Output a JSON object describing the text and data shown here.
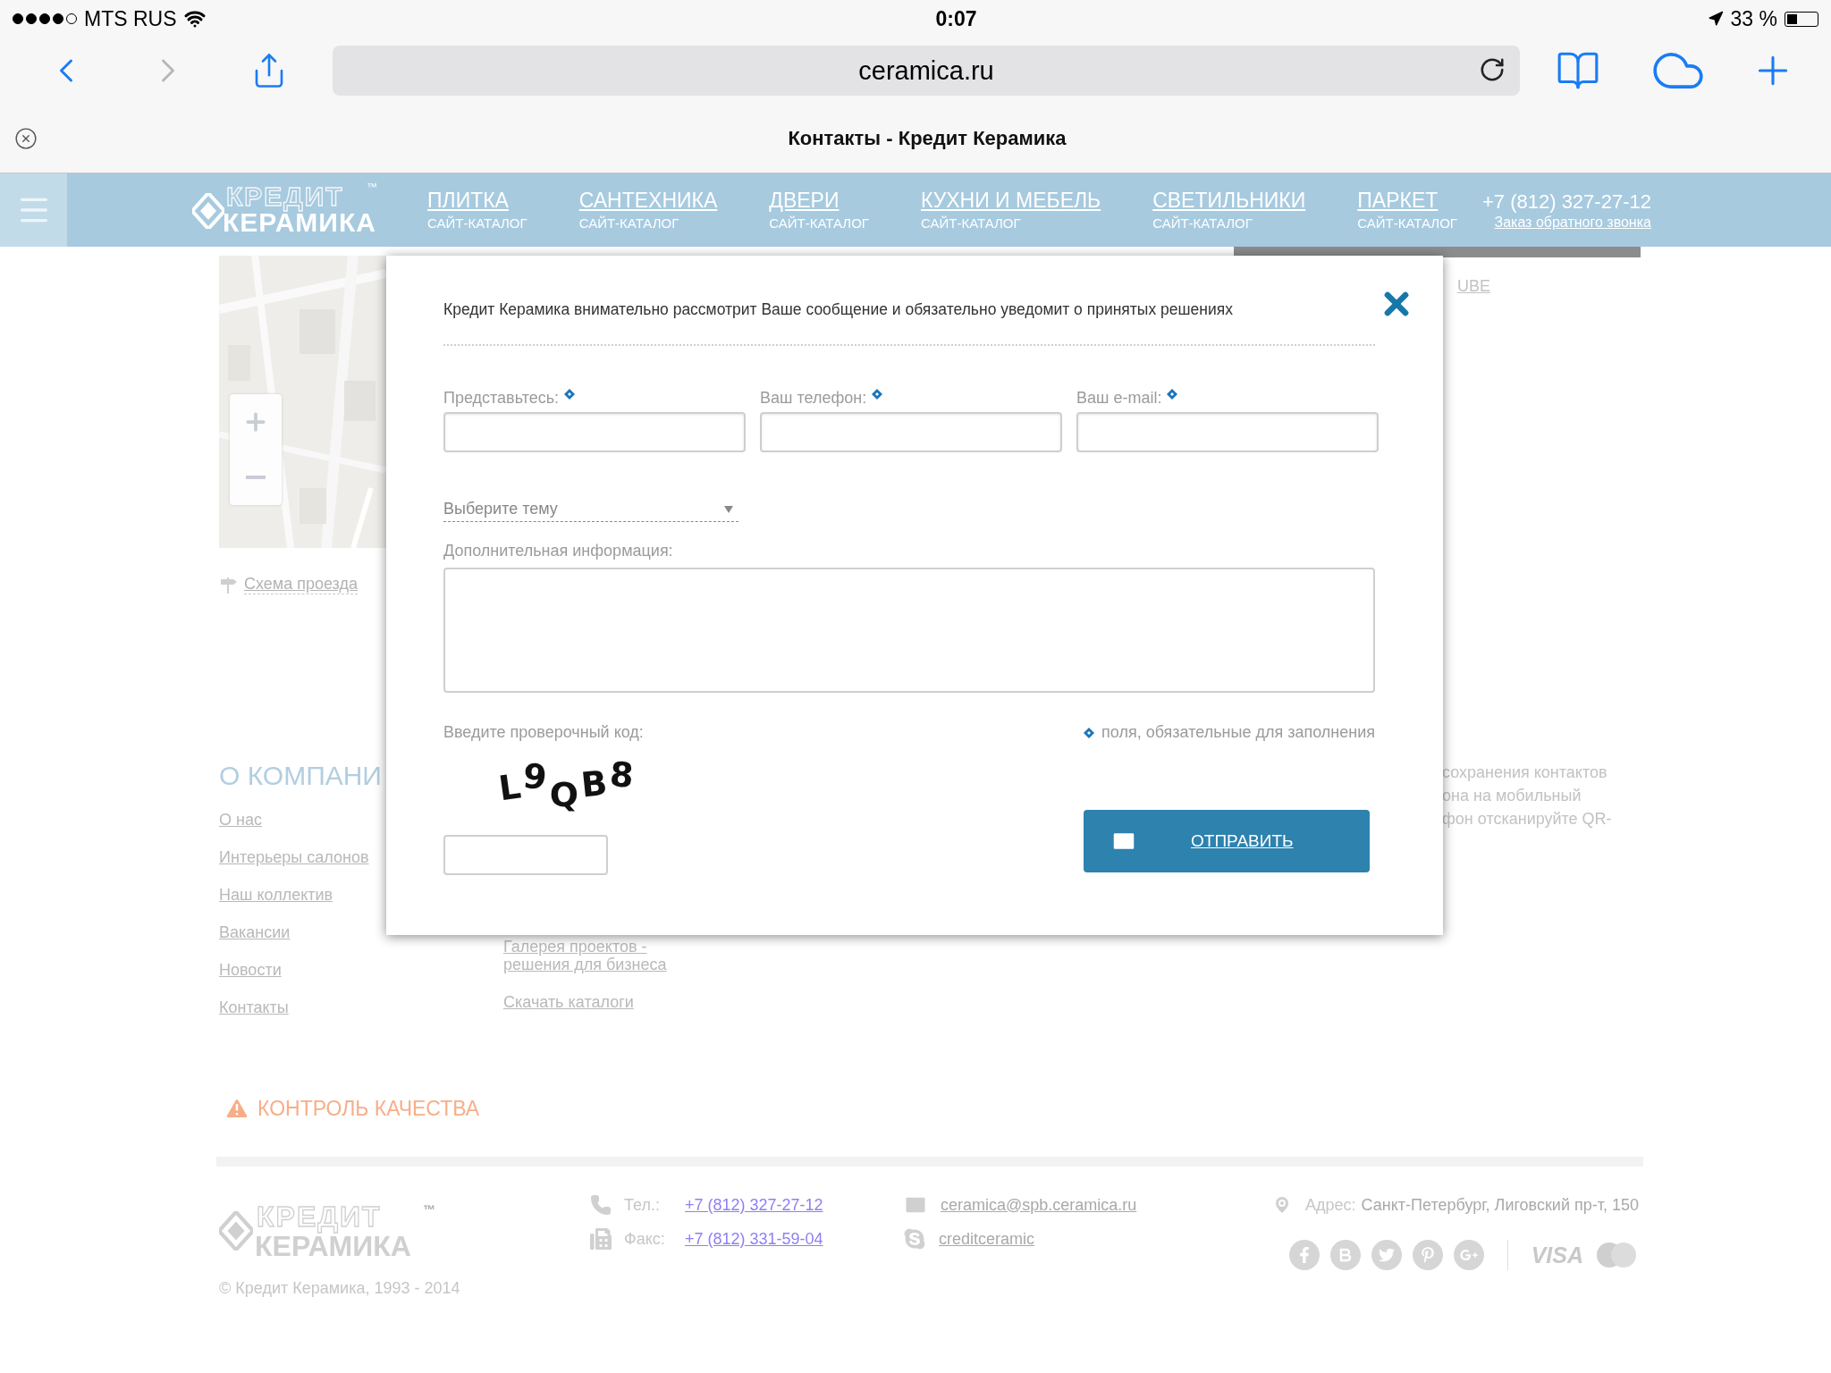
{
  "status_bar": {
    "carrier": "MTS RUS",
    "time": "0:07",
    "battery": "33 %"
  },
  "browser": {
    "url": "ceramica.ru",
    "tab_title": "Контакты - Кредит Керамика",
    "back_disabled": false,
    "forward_disabled": true
  },
  "nav": {
    "logo_top": "КРЕДИТ",
    "logo_bottom": "КЕРАМИКА",
    "logo_tm": "™",
    "items": [
      {
        "label": "ПЛИТКА",
        "sub": "САЙТ-КАТАЛОГ"
      },
      {
        "label": "САНТЕХНИКА",
        "sub": "САЙТ-КАТАЛОГ"
      },
      {
        "label": "ДВЕРИ",
        "sub": "САЙТ-КАТАЛОГ"
      },
      {
        "label": "КУХНИ И МЕБЕЛЬ",
        "sub": "САЙТ-КАТАЛОГ"
      },
      {
        "label": "СВЕТИЛЬНИКИ",
        "sub": "САЙТ-КАТАЛОГ"
      },
      {
        "label": "ПАРКЕТ",
        "sub": "САЙТ-КАТАЛОГ"
      }
    ],
    "phone": "+7 (812) 327-27-12",
    "callback": "Заказ обратного звонка"
  },
  "page": {
    "map": {
      "kind": "picture"
    },
    "route_link": "Схема проезда",
    "cut_link": "UBE",
    "company_heading": "О КОМПАНИ",
    "company_links": [
      "О нас",
      "Интерьеры салонов",
      "Наш коллектив",
      "Вакансии",
      "Новости",
      "Контакты"
    ],
    "other_links": [
      "Галерея проектов - решения для бизнеса",
      "Скачать каталоги"
    ],
    "qr_lines": [
      "сохранения контактов",
      "она на мобильный",
      "фон отсканируйте QR-"
    ],
    "quality": "КОНТРОЛЬ КАЧЕСТВА"
  },
  "footer": {
    "logo_top": "КРЕДИТ",
    "logo_bottom": "КЕРАМИКА",
    "logo_tm": "™",
    "copyright": "© Кредит Керамика, 1993 - 2014",
    "tel_label": "Тел.:",
    "tel": "+7 (812) 327-27-12",
    "fax_label": "Факс:",
    "fax": "+7 (812) 331-59-04",
    "email": "ceramica@spb.ceramica.ru",
    "skype": "creditceramic",
    "address_label": "Адрес:",
    "address": "Санкт-Петербург, Лиговский пр-т, 150",
    "card": "VISA"
  },
  "modal": {
    "intro": "Кредит Керамика внимательно рассмотрит Ваше сообщение и обязательно уведомит о принятых решениях",
    "fields": [
      {
        "label": "Представьтесь:",
        "required": true
      },
      {
        "label": "Ваш телефон:",
        "required": true
      },
      {
        "label": "Ваш e-mail:",
        "required": true
      }
    ],
    "topic": "Выберите тему",
    "info_label": "Дополнительная информация:",
    "captcha_label": "Введите проверочный код:",
    "captcha": "L9QB8",
    "required_note": "поля, обязательные для заполнения",
    "submit": "ОТПРАВИТЬ"
  }
}
